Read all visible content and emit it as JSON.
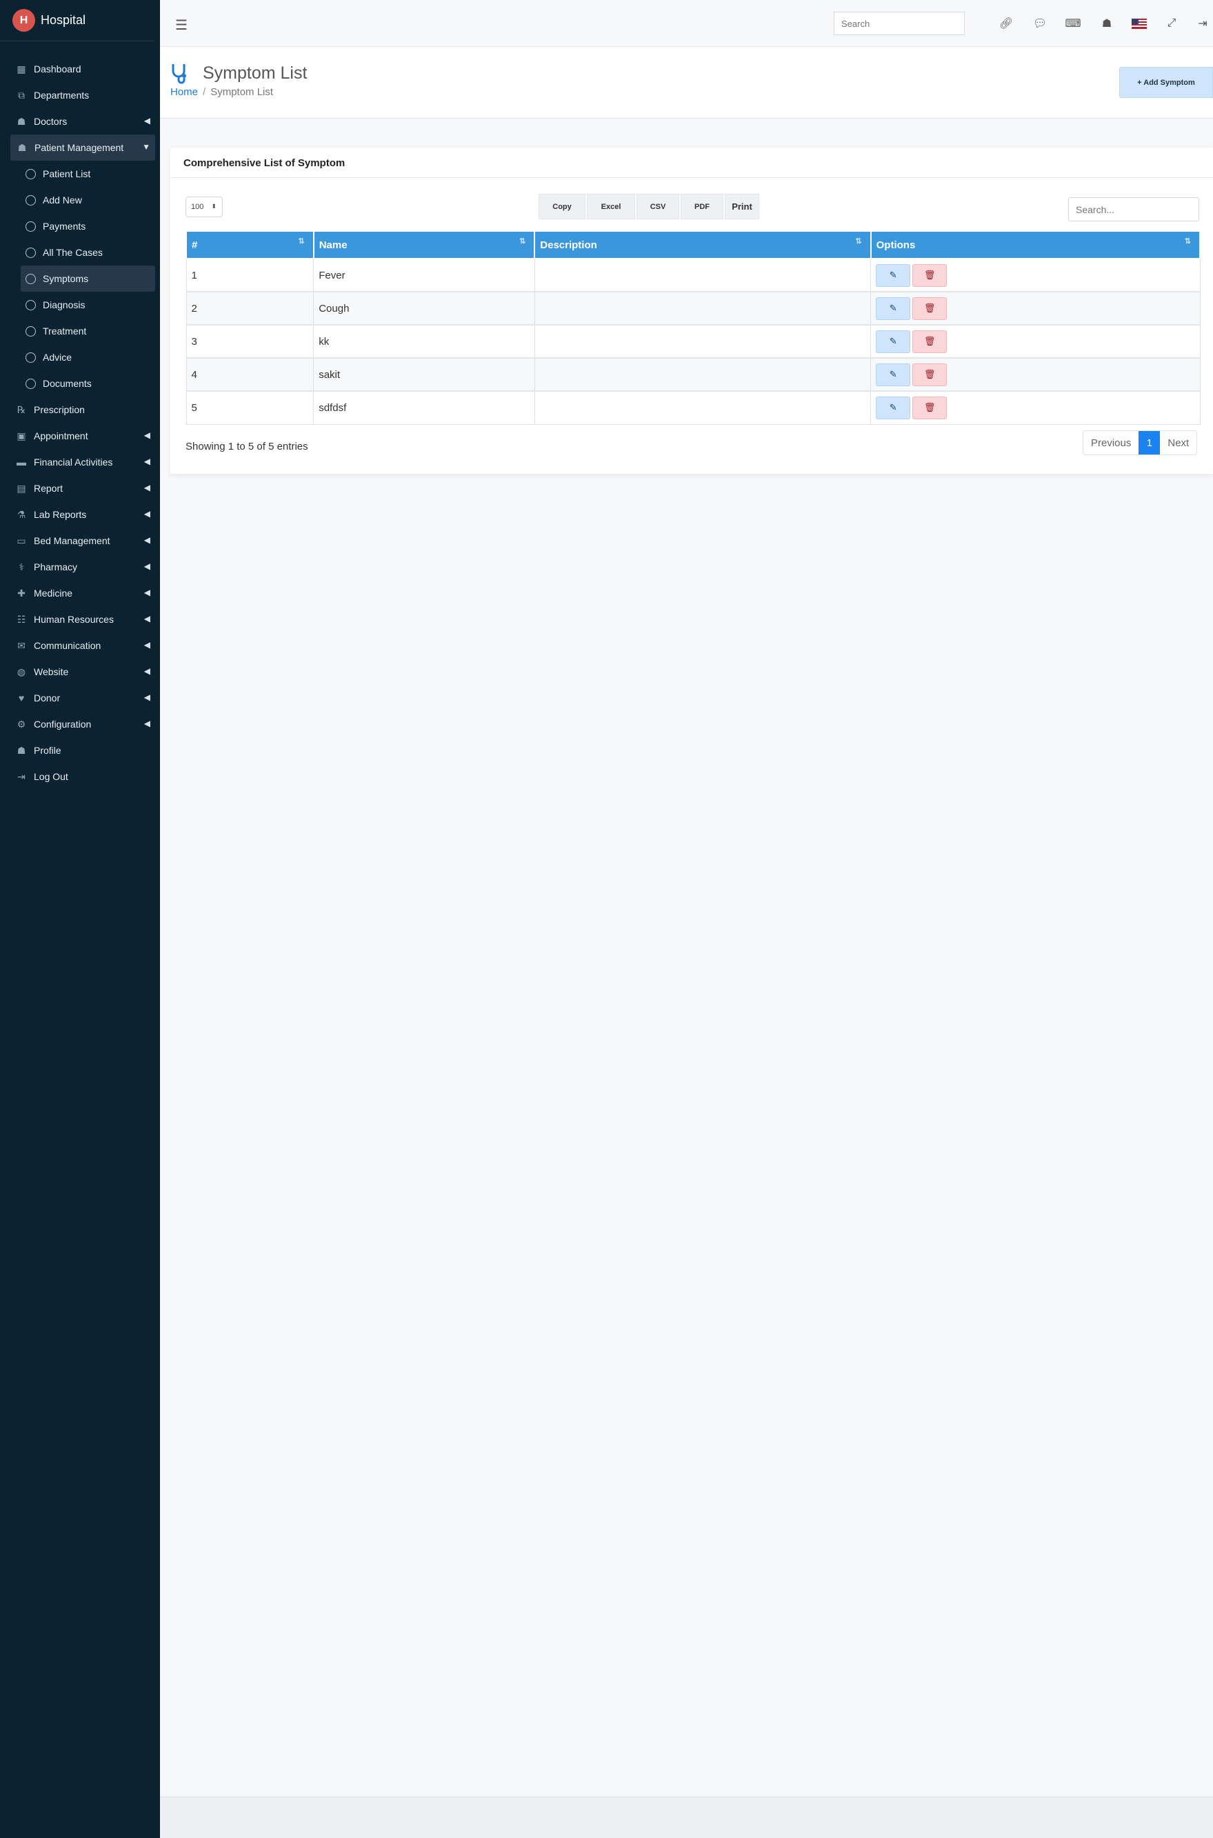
{
  "app": {
    "title": "Hospital",
    "logo_letter": "H"
  },
  "sidebar": {
    "items": [
      {
        "label": "Dashboard",
        "icon": "grid-icon",
        "glyph": "▦"
      },
      {
        "label": "Departments",
        "icon": "sitemap-icon",
        "glyph": "⧉"
      },
      {
        "label": "Doctors",
        "icon": "user-md-icon",
        "glyph": "☗"
      },
      {
        "label": "Patient Management",
        "icon": "user-icon",
        "glyph": "☗"
      },
      {
        "label": "Prescription",
        "icon": "prescription-icon",
        "glyph": "℞"
      },
      {
        "label": "Appointment",
        "icon": "calendar-icon",
        "glyph": "▣"
      },
      {
        "label": "Financial Activities",
        "icon": "card-icon",
        "glyph": "▬"
      },
      {
        "label": "Report",
        "icon": "report-icon",
        "glyph": "▤"
      },
      {
        "label": "Lab Reports",
        "icon": "flask-icon",
        "glyph": "⚗"
      },
      {
        "label": "Bed Management",
        "icon": "bed-icon",
        "glyph": "▭"
      },
      {
        "label": "Pharmacy",
        "icon": "pills-icon",
        "glyph": "⚕"
      },
      {
        "label": "Medicine",
        "icon": "medkit-icon",
        "glyph": "✚"
      },
      {
        "label": "Human Resources",
        "icon": "users-icon",
        "glyph": "☷"
      },
      {
        "label": "Communication",
        "icon": "comments-icon",
        "glyph": "✉"
      },
      {
        "label": "Website",
        "icon": "globe-icon",
        "glyph": "◍"
      },
      {
        "label": "Donor",
        "icon": "donor-icon",
        "glyph": "♥"
      },
      {
        "label": "Configuration",
        "icon": "gear-icon",
        "glyph": "⚙"
      },
      {
        "label": "Profile",
        "icon": "profile-icon",
        "glyph": "☗"
      },
      {
        "label": "Log Out",
        "icon": "logout-icon",
        "glyph": "⇥"
      }
    ],
    "sub_items": [
      {
        "label": "Patient List"
      },
      {
        "label": "Add New"
      },
      {
        "label": "Payments"
      },
      {
        "label": "All The Cases"
      },
      {
        "label": "Symptoms"
      },
      {
        "label": "Diagnosis"
      },
      {
        "label": "Treatment"
      },
      {
        "label": "Advice"
      },
      {
        "label": "Documents"
      }
    ]
  },
  "topbar": {
    "search_placeholder": "Search",
    "icons": [
      "link-icon",
      "chat-icon",
      "keyboard-icon",
      "user-icon",
      "us-flag-icon",
      "fullscreen-icon",
      "logout-icon"
    ]
  },
  "header": {
    "title": "Symptom List",
    "breadcrumb_home": "Home",
    "breadcrumb_current": "Symptom List",
    "add_button": "+ Add Symptom"
  },
  "card": {
    "title": "Comprehensive List of Symptom",
    "page_length": "100",
    "export_buttons": [
      "Copy",
      "Excel",
      "CSV",
      "PDF",
      "Print"
    ],
    "search_placeholder": "Search...",
    "columns": [
      "#",
      "Name",
      "Description",
      "Options"
    ],
    "rows": [
      {
        "num": "1",
        "name": "Fever",
        "description": ""
      },
      {
        "num": "2",
        "name": "Cough",
        "description": ""
      },
      {
        "num": "3",
        "name": "kk",
        "description": ""
      },
      {
        "num": "4",
        "name": "sakit",
        "description": ""
      },
      {
        "num": "5",
        "name": "sdfdsf",
        "description": ""
      }
    ],
    "info": "Showing 1 to 5 of 5 entries",
    "pager": {
      "previous": "Previous",
      "current": "1",
      "next": "Next"
    }
  },
  "colors": {
    "sidebar": "#0b2231",
    "table_header": "#3a97dc",
    "accent": "#1e7ad3"
  }
}
